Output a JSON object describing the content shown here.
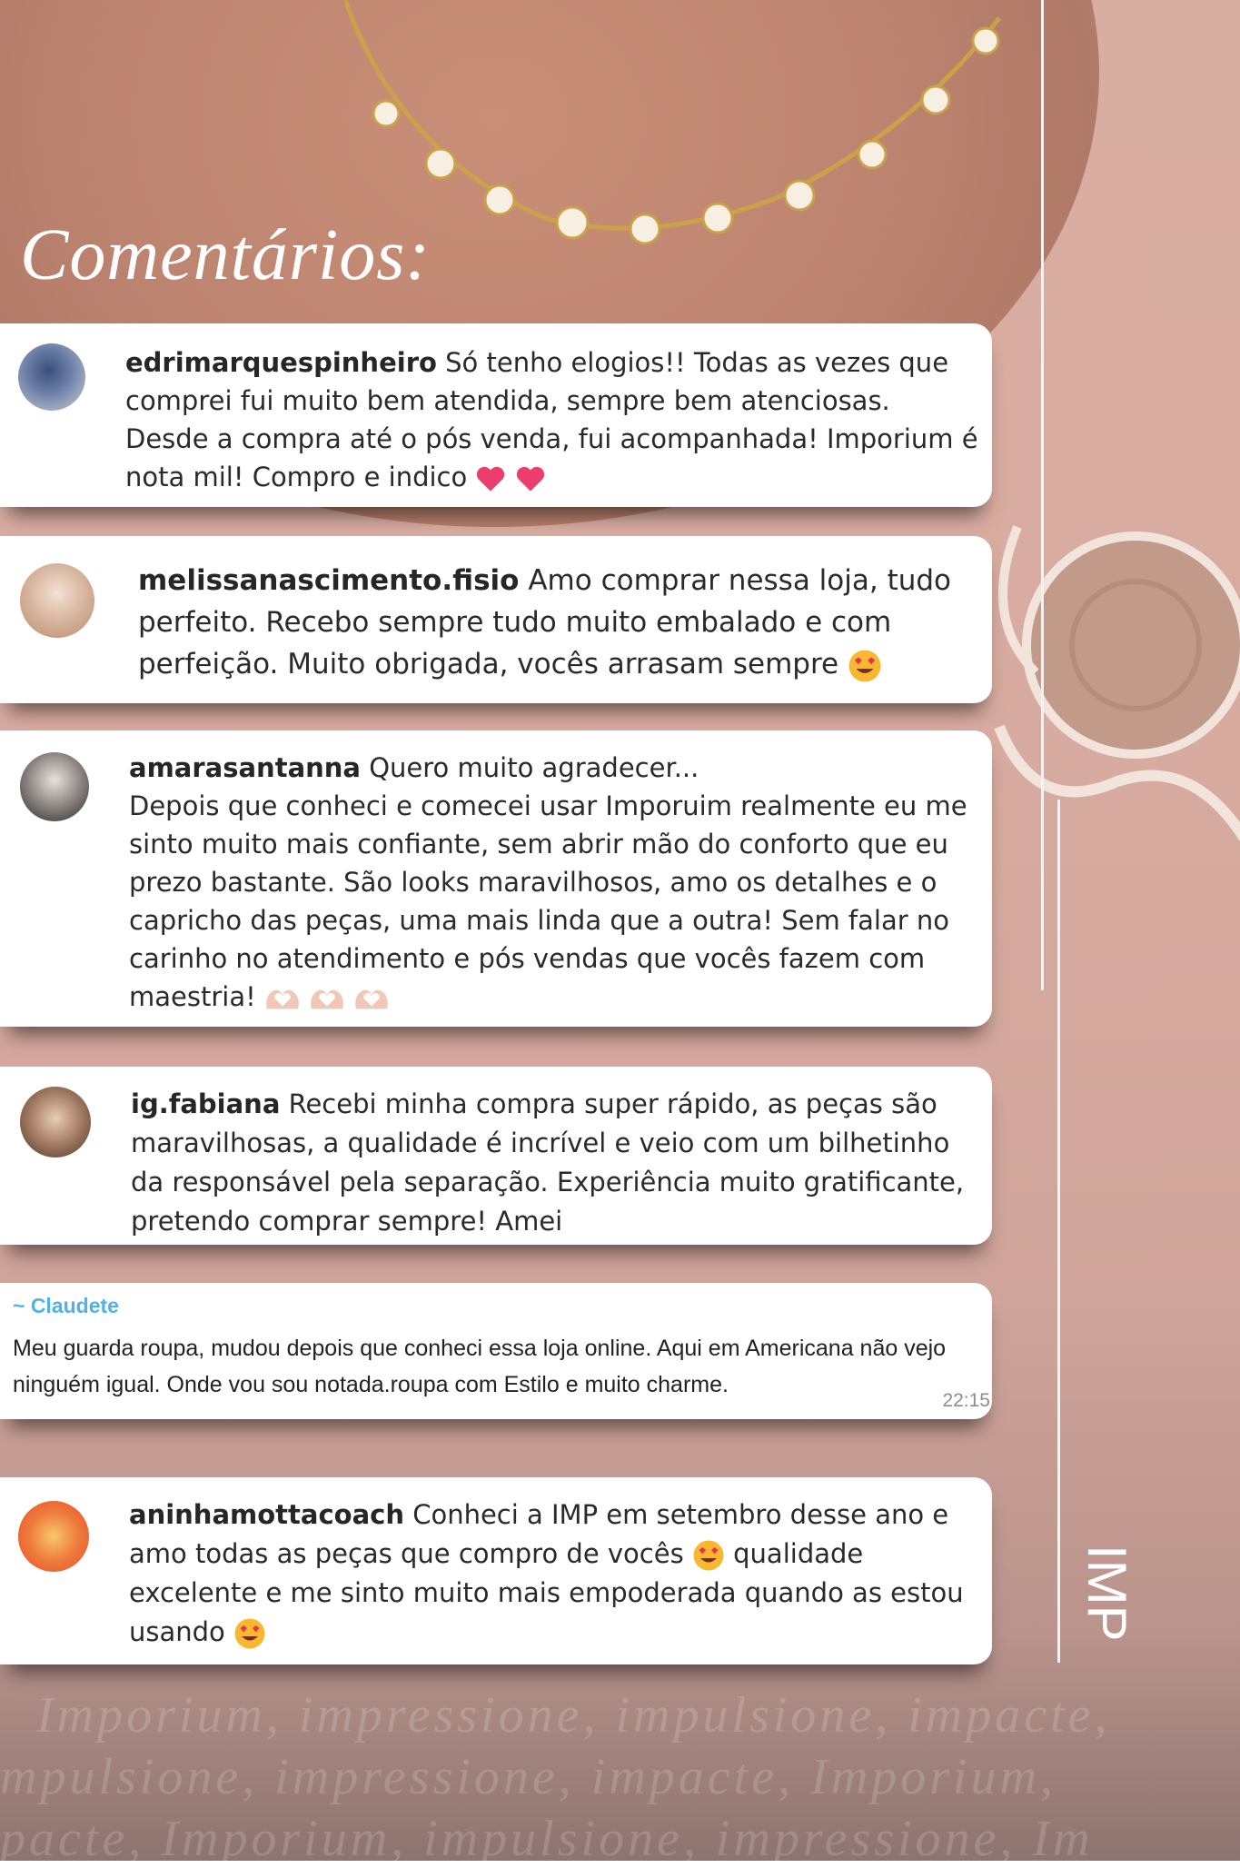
{
  "title": "Comentários:",
  "comments": [
    {
      "username": "edrimarquespinheiro",
      "text": "Só tenho elogios!! Todas as vezes que comprei fui muito bem atendida, sempre bem atenciosas. Desde a compra até o pós venda, fui acompanhada! Imporium é nota mil! Compro e indico",
      "emoji": [
        "heart-icon",
        "heart-icon"
      ]
    },
    {
      "username": "melissanascimento.fisio",
      "text": "Amo comprar nessa loja, tudo perfeito. Recebo sempre tudo muito embalado e com perfeição. Muito obrigada, vocês arrasam sempre",
      "emoji": [
        "heart-eyes-icon"
      ]
    },
    {
      "username": "amarasantanna",
      "text_line1": "Quero muito agradecer...",
      "text": "Depois que conheci e comecei usar Imporuim realmente eu me sinto muito mais confiante, sem abrir mão do conforto que eu prezo bastante. São looks maravilhosos, amo os detalhes e o capricho das peças, uma mais linda que a outra! Sem falar no carinho no atendimento e pós vendas que vocês fazem com maestria!",
      "emoji": [
        "heart-hands-icon",
        "heart-hands-icon",
        "heart-hands-icon"
      ]
    },
    {
      "username": "ig.fabiana",
      "text": "Recebi minha compra super rápido, as peças são maravilhosas, a qualidade é incrível e veio com um bilhetinho da responsável pela separação. Experiência muito gratificante, pretendo comprar sempre! Amei"
    },
    {
      "sender": "~ Claudete",
      "text": "Meu guarda roupa, mudou depois que conheci essa loja online. Aqui em Americana não vejo ninguém igual. Onde vou sou notada.roupa com Estilo e muito charme.",
      "time": "22:15"
    },
    {
      "username": "aninhamottacoach",
      "text_a": "Conheci a IMP em setembro desse ano e amo todas as peças que compro de vocês",
      "text_b": "qualidade excelente e me sinto muito mais empoderada quando as estou usando",
      "emoji": [
        "heart-eyes-icon",
        "heart-eyes-icon"
      ]
    }
  ],
  "watermark_lines": [
    "Imporium, impressione, impulsione, impacte,",
    "mpulsione, impressione, impacte, Imporium,",
    "pacte, Imporium, impulsione, impressione, Im"
  ],
  "logo_text": "IMP",
  "colors": {
    "card": "#ffffff",
    "background": "#d9aea2",
    "whatsapp_sender": "#4fb3e6",
    "title": "#ffffff"
  }
}
